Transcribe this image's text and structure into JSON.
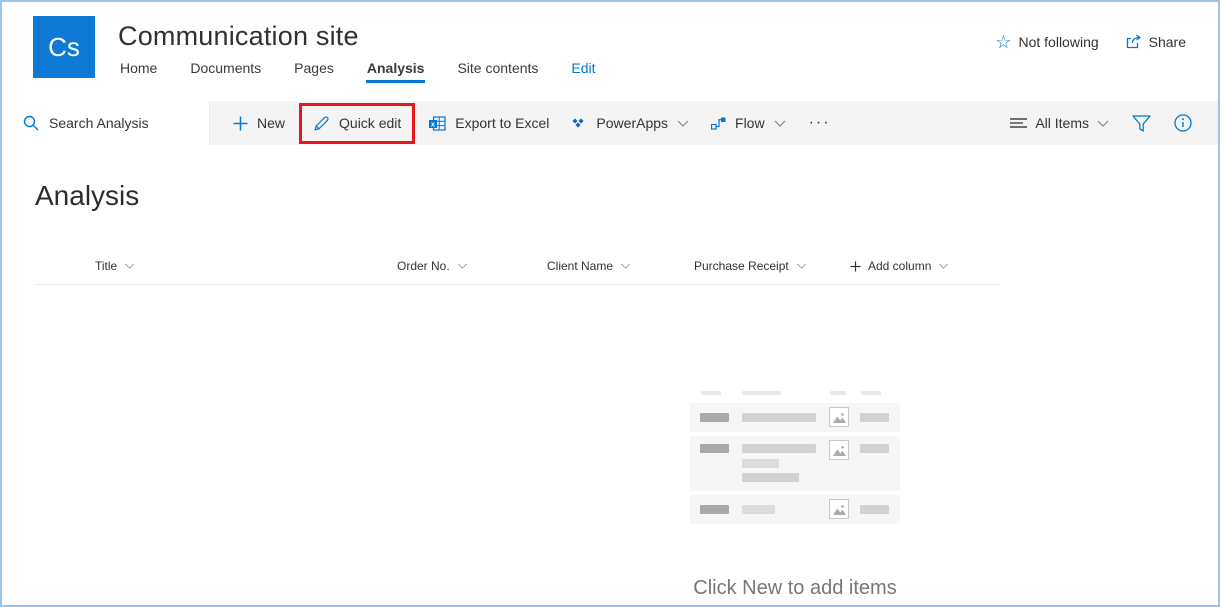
{
  "header": {
    "logo_text": "Cs",
    "site_title": "Communication site",
    "nav": {
      "home": "Home",
      "documents": "Documents",
      "pages": "Pages",
      "analysis": "Analysis",
      "site_contents": "Site contents",
      "edit": "Edit"
    },
    "follow_label": "Not following",
    "share_label": "Share"
  },
  "toolbar": {
    "search_placeholder": "Search Analysis",
    "new_label": "New",
    "quick_edit_label": "Quick edit",
    "export_label": "Export to Excel",
    "powerapps_label": "PowerApps",
    "flow_label": "Flow",
    "overflow_label": "···",
    "view_label": "All Items"
  },
  "main": {
    "page_title": "Analysis",
    "columns": [
      "Title",
      "Order No.",
      "Client Name",
      "Purchase Receipt"
    ],
    "add_column_label": "Add column",
    "empty_state_text": "Click New to add items"
  },
  "colors": {
    "accent": "#0078d4",
    "logo_bg": "#0e7ad6",
    "toolbar_bg": "#f4f4f4",
    "annotation_red": "#e8171d",
    "frame_border": "#9dc3e6",
    "nav_active_underline": "#0078d4"
  }
}
